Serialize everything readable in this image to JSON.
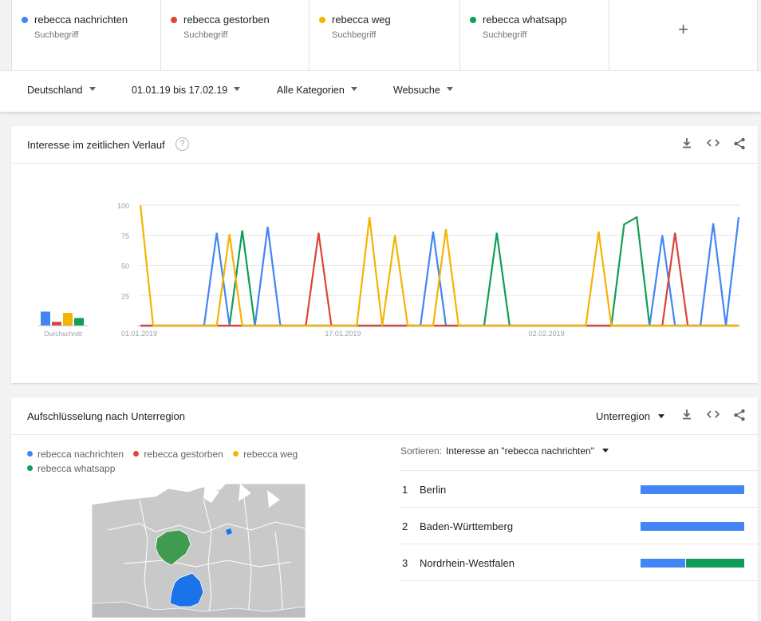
{
  "terms": [
    {
      "name": "rebecca nachrichten",
      "sub": "Suchbegriff",
      "color": "#4285f4"
    },
    {
      "name": "rebecca gestorben",
      "sub": "Suchbegriff",
      "color": "#db4437"
    },
    {
      "name": "rebecca weg",
      "sub": "Suchbegriff",
      "color": "#f4b400"
    },
    {
      "name": "rebecca whatsapp",
      "sub": "Suchbegriff",
      "color": "#0f9d58"
    }
  ],
  "add_label": "+",
  "filters": {
    "region": "Deutschland",
    "range": "01.01.19 bis 17.02.19",
    "category": "Alle Kategorien",
    "search_type": "Websuche"
  },
  "interest_card": {
    "title": "Interesse im zeitlichen Verlauf",
    "help": "?",
    "avg_label": "Durchschnitt"
  },
  "chart_data": {
    "type": "line",
    "x_start": "01.01.2019",
    "x_end": "17.02.2019",
    "x_tick_labels": [
      "01.01.2019",
      "17.01.2019",
      "02.02.2019"
    ],
    "y_ticks": [
      25,
      50,
      75,
      100
    ],
    "ylim": [
      0,
      100
    ],
    "grid": true,
    "series": [
      {
        "name": "rebecca nachrichten",
        "color": "#4285f4",
        "values": [
          0,
          0,
          0,
          0,
          0,
          0,
          77,
          0,
          0,
          0,
          82,
          0,
          0,
          0,
          0,
          0,
          0,
          0,
          0,
          0,
          0,
          0,
          0,
          78,
          0,
          0,
          0,
          0,
          0,
          0,
          0,
          0,
          0,
          0,
          0,
          0,
          0,
          0,
          0,
          0,
          0,
          75,
          0,
          0,
          0,
          85,
          0,
          90
        ]
      },
      {
        "name": "rebecca gestorben",
        "color": "#db4437",
        "values": [
          0,
          0,
          0,
          0,
          0,
          0,
          0,
          0,
          0,
          0,
          0,
          0,
          0,
          0,
          77,
          0,
          0,
          0,
          0,
          0,
          0,
          0,
          0,
          0,
          0,
          0,
          0,
          0,
          0,
          0,
          0,
          0,
          0,
          0,
          0,
          0,
          0,
          0,
          0,
          0,
          0,
          0,
          77,
          0,
          0,
          0,
          0,
          0
        ]
      },
      {
        "name": "rebecca weg",
        "color": "#f4b400",
        "values": [
          100,
          0,
          0,
          0,
          0,
          0,
          0,
          76,
          0,
          0,
          0,
          0,
          0,
          0,
          0,
          0,
          0,
          0,
          90,
          0,
          75,
          0,
          0,
          0,
          80,
          0,
          0,
          0,
          0,
          0,
          0,
          0,
          0,
          0,
          0,
          0,
          78,
          0,
          0,
          0,
          0,
          0,
          0,
          0,
          0,
          0,
          0,
          0
        ]
      },
      {
        "name": "rebecca whatsapp",
        "color": "#0f9d58",
        "values": [
          0,
          0,
          0,
          0,
          0,
          0,
          0,
          0,
          79,
          0,
          0,
          0,
          0,
          0,
          0,
          0,
          0,
          0,
          0,
          0,
          0,
          0,
          0,
          0,
          0,
          0,
          0,
          0,
          77,
          0,
          0,
          0,
          0,
          0,
          0,
          0,
          0,
          0,
          84,
          90,
          0,
          0,
          0,
          0,
          0,
          0,
          0,
          0
        ]
      }
    ],
    "averages": [
      {
        "name": "rebecca nachrichten",
        "value": 11,
        "color": "#4285f4"
      },
      {
        "name": "rebecca gestorben",
        "value": 3,
        "color": "#db4437"
      },
      {
        "name": "rebecca weg",
        "value": 10,
        "color": "#f4b400"
      },
      {
        "name": "rebecca whatsapp",
        "value": 6,
        "color": "#0f9d58"
      }
    ]
  },
  "region_card": {
    "title": "Aufschlüsselung nach Unterregion",
    "view_select": "Unterregion",
    "legend": [
      {
        "name": "rebecca nachrichten",
        "color": "#4285f4"
      },
      {
        "name": "rebecca gestorben",
        "color": "#db4437"
      },
      {
        "name": "rebecca weg",
        "color": "#f4b400"
      },
      {
        "name": "rebecca whatsapp",
        "color": "#0f9d58"
      }
    ],
    "sort_label": "Sortieren:",
    "sort_value": "Interesse an \"rebecca nachrichten\"",
    "rows": [
      {
        "rank": "1",
        "name": "Berlin",
        "shares": [
          {
            "color": "#4285f4",
            "value": 1.0
          }
        ]
      },
      {
        "rank": "2",
        "name": "Baden-Württemberg",
        "shares": [
          {
            "color": "#4285f4",
            "value": 1.0
          }
        ]
      },
      {
        "rank": "3",
        "name": "Nordrhein-Westfalen",
        "shares": [
          {
            "color": "#4285f4",
            "value": 0.43
          },
          {
            "color": "#0f9d58",
            "value": 0.57
          }
        ]
      }
    ]
  }
}
